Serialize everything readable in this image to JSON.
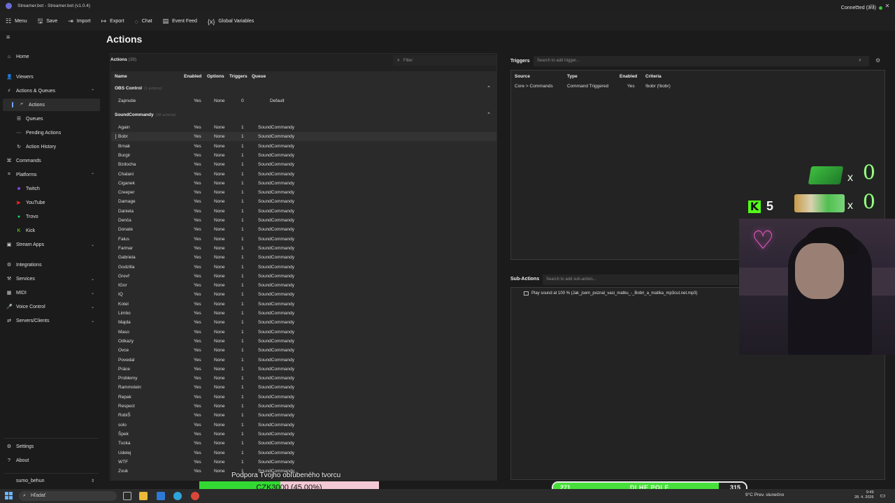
{
  "window": {
    "title": "Streamer.bot - Streamer.bot (v1.0.4)"
  },
  "menu": [
    {
      "icon": "grid-icon",
      "glyph": "☷",
      "label": "Menu"
    },
    {
      "icon": "save-icon",
      "glyph": "🖫",
      "label": "Save"
    },
    {
      "icon": "import-icon",
      "glyph": "⇥",
      "label": "Import"
    },
    {
      "icon": "export-icon",
      "glyph": "↦",
      "label": "Export"
    },
    {
      "icon": "chat-icon",
      "glyph": "◌",
      "label": "Chat"
    },
    {
      "icon": "event-feed-icon",
      "glyph": "▤",
      "label": "Event Feed"
    },
    {
      "icon": "variables-icon",
      "glyph": "{x}",
      "label": "Global Variables"
    }
  ],
  "connection": {
    "label": "Connected (3/3)",
    "color": "#3fbf3f"
  },
  "sidebar": {
    "items": [
      {
        "label": "Home",
        "glyph": "⌂",
        "name": "home"
      },
      {
        "label": "Viewers",
        "glyph": "👤",
        "name": "viewers"
      },
      {
        "label": "Actions & Queues",
        "glyph": "⚡",
        "name": "actions-queues",
        "chev": "⌃"
      },
      {
        "label": "Actions",
        "glyph": "🗲",
        "name": "actions",
        "sub": true,
        "active": true
      },
      {
        "label": "Queues",
        "glyph": "☰",
        "name": "queues",
        "sub": true
      },
      {
        "label": "Pending Actions",
        "glyph": "⋯",
        "name": "pending-actions",
        "sub": true
      },
      {
        "label": "Action History",
        "glyph": "↻",
        "name": "action-history",
        "sub": true
      },
      {
        "label": "Commands",
        "glyph": "⌘",
        "name": "commands"
      },
      {
        "label": "Platforms",
        "glyph": "⌗",
        "name": "platforms",
        "chev": "⌃"
      },
      {
        "label": "Twitch",
        "glyph": "■",
        "name": "twitch",
        "sub": true,
        "color": "#9146ff"
      },
      {
        "label": "YouTube",
        "glyph": "▶",
        "name": "youtube",
        "sub": true,
        "color": "#ff2020"
      },
      {
        "label": "Trovo",
        "glyph": "●",
        "name": "trovo",
        "sub": true,
        "color": "#19d66b"
      },
      {
        "label": "Kick",
        "glyph": "K",
        "name": "kick",
        "sub": true,
        "color": "#53fc18"
      },
      {
        "label": "Stream Apps",
        "glyph": "▣",
        "name": "stream-apps",
        "chev": "⌄"
      },
      {
        "label": "Integrations",
        "glyph": "⚙",
        "name": "integrations"
      },
      {
        "label": "Services",
        "glyph": "⚒",
        "name": "services",
        "chev": "⌄"
      },
      {
        "label": "MIDI",
        "glyph": "▦",
        "name": "midi",
        "chev": "⌄"
      },
      {
        "label": "Voice Control",
        "glyph": "🎤",
        "name": "voice-control",
        "chev": "⌄"
      },
      {
        "label": "Servers/Clients",
        "glyph": "⇄",
        "name": "servers-clients",
        "chev": "⌄"
      }
    ],
    "bottom": [
      {
        "label": "Settings",
        "glyph": "⚙",
        "name": "settings"
      },
      {
        "label": "About",
        "glyph": "?",
        "name": "about"
      }
    ],
    "user": {
      "label": "sumo_behun",
      "chev": "⇕"
    }
  },
  "page": {
    "title": "Actions"
  },
  "actions": {
    "heading": "Actions",
    "count": "(39)",
    "filter_placeholder": "Filter",
    "columns": {
      "name": "Name",
      "enabled": "Enabled",
      "options": "Options",
      "triggers": "Triggers",
      "queue": "Queue"
    },
    "groups": [
      {
        "name": "OBS Control",
        "count": "(1 actions)",
        "rows": [
          {
            "name": "Zapnutie",
            "enabled": "Yes",
            "options": "None",
            "triggers": "0",
            "queue": "Default"
          }
        ]
      },
      {
        "name": "SoundCommandy",
        "count": "(38 actions)",
        "rows": [
          {
            "name": "Again",
            "enabled": "Yes",
            "options": "None",
            "triggers": "1",
            "queue": "SoundCommandy"
          },
          {
            "name": "Bobr",
            "enabled": "Yes",
            "options": "None",
            "triggers": "1",
            "queue": "SoundCommandy",
            "selected": true
          },
          {
            "name": "Brnak",
            "enabled": "Yes",
            "options": "None",
            "triggers": "1",
            "queue": "SoundCommandy"
          },
          {
            "name": "Burgir",
            "enabled": "Yes",
            "options": "None",
            "triggers": "1",
            "queue": "SoundCommandy"
          },
          {
            "name": "Bzdocha",
            "enabled": "Yes",
            "options": "None",
            "triggers": "1",
            "queue": "SoundCommandy"
          },
          {
            "name": "Chalani",
            "enabled": "Yes",
            "options": "None",
            "triggers": "1",
            "queue": "SoundCommandy"
          },
          {
            "name": "Ciganek",
            "enabled": "Yes",
            "options": "None",
            "triggers": "1",
            "queue": "SoundCommandy"
          },
          {
            "name": "Creeper",
            "enabled": "Yes",
            "options": "None",
            "triggers": "1",
            "queue": "SoundCommandy"
          },
          {
            "name": "Damage",
            "enabled": "Yes",
            "options": "None",
            "triggers": "1",
            "queue": "SoundCommandy"
          },
          {
            "name": "Daniela",
            "enabled": "Yes",
            "options": "None",
            "triggers": "1",
            "queue": "SoundCommandy"
          },
          {
            "name": "Denča",
            "enabled": "Yes",
            "options": "None",
            "triggers": "1",
            "queue": "SoundCommandy"
          },
          {
            "name": "Donate",
            "enabled": "Yes",
            "options": "None",
            "triggers": "1",
            "queue": "SoundCommandy"
          },
          {
            "name": "Falus",
            "enabled": "Yes",
            "options": "None",
            "triggers": "1",
            "queue": "SoundCommandy"
          },
          {
            "name": "Farmar",
            "enabled": "Yes",
            "options": "None",
            "triggers": "1",
            "queue": "SoundCommandy"
          },
          {
            "name": "Gabriela",
            "enabled": "Yes",
            "options": "None",
            "triggers": "1",
            "queue": "SoundCommandy"
          },
          {
            "name": "Godzilla",
            "enabled": "Yes",
            "options": "None",
            "triggers": "1",
            "queue": "SoundCommandy"
          },
          {
            "name": "Grevf",
            "enabled": "Yes",
            "options": "None",
            "triggers": "1",
            "queue": "SoundCommandy"
          },
          {
            "name": "IGor",
            "enabled": "Yes",
            "options": "None",
            "triggers": "1",
            "queue": "SoundCommandy"
          },
          {
            "name": "IQ",
            "enabled": "Yes",
            "options": "None",
            "triggers": "1",
            "queue": "SoundCommandy"
          },
          {
            "name": "Kotel",
            "enabled": "Yes",
            "options": "None",
            "triggers": "1",
            "queue": "SoundCommandy"
          },
          {
            "name": "Limbo",
            "enabled": "Yes",
            "options": "None",
            "triggers": "1",
            "queue": "SoundCommandy"
          },
          {
            "name": "Majda",
            "enabled": "Yes",
            "options": "None",
            "triggers": "1",
            "queue": "SoundCommandy"
          },
          {
            "name": "Maso",
            "enabled": "Yes",
            "options": "None",
            "triggers": "1",
            "queue": "SoundCommandy"
          },
          {
            "name": "Odkazy",
            "enabled": "Yes",
            "options": "None",
            "triggers": "1",
            "queue": "SoundCommandy"
          },
          {
            "name": "Ovce",
            "enabled": "Yes",
            "options": "None",
            "triggers": "1",
            "queue": "SoundCommandy"
          },
          {
            "name": "Povedal",
            "enabled": "Yes",
            "options": "None",
            "triggers": "1",
            "queue": "SoundCommandy"
          },
          {
            "name": "Práce",
            "enabled": "Yes",
            "options": "None",
            "triggers": "1",
            "queue": "SoundCommandy"
          },
          {
            "name": "Problemy",
            "enabled": "Yes",
            "options": "None",
            "triggers": "1",
            "queue": "SoundCommandy"
          },
          {
            "name": "Rammstein",
            "enabled": "Yes",
            "options": "None",
            "triggers": "1",
            "queue": "SoundCommandy"
          },
          {
            "name": "Repak",
            "enabled": "Yes",
            "options": "None",
            "triggers": "1",
            "queue": "SoundCommandy"
          },
          {
            "name": "Respect",
            "enabled": "Yes",
            "options": "None",
            "triggers": "1",
            "queue": "SoundCommandy"
          },
          {
            "name": "RobiŠ",
            "enabled": "Yes",
            "options": "None",
            "triggers": "1",
            "queue": "SoundCommandy"
          },
          {
            "name": "solo",
            "enabled": "Yes",
            "options": "None",
            "triggers": "1",
            "queue": "SoundCommandy"
          },
          {
            "name": "Špek",
            "enabled": "Yes",
            "options": "None",
            "triggers": "1",
            "queue": "SoundCommandy"
          },
          {
            "name": "Tucka",
            "enabled": "Yes",
            "options": "None",
            "triggers": "1",
            "queue": "SoundCommandy"
          },
          {
            "name": "Udelej",
            "enabled": "Yes",
            "options": "None",
            "triggers": "1",
            "queue": "SoundCommandy"
          },
          {
            "name": "WTF",
            "enabled": "Yes",
            "options": "None",
            "triggers": "1",
            "queue": "SoundCommandy"
          },
          {
            "name": "Zvuk",
            "enabled": "Yes",
            "options": "None",
            "triggers": "1",
            "queue": "SoundCommandy"
          }
        ]
      }
    ]
  },
  "triggers": {
    "title": "Triggers",
    "search_placeholder": "Search to add trigger...",
    "columns": {
      "source": "Source",
      "type": "Type",
      "enabled": "Enabled",
      "criteria": "Criteria"
    },
    "rows": [
      {
        "source": "Core > Commands",
        "type": "Command Triggered",
        "enabled": "Yes",
        "criteria": "!bobr (!bobr)"
      }
    ]
  },
  "subactions": {
    "title": "Sub-Actions",
    "search_placeholder": "Search to add sub-action...",
    "items": [
      "Play sound at 100 % (Jak_jsem_poznal_vasi_matku_-_Bobri_a_matika_mp3cut.net.mp3)"
    ]
  },
  "overlay": {
    "kick_count": "5",
    "shot_counts": [
      "0",
      "0"
    ],
    "x_mark": "x",
    "support_text": "Podpora Tvojho obľúbeného tvorcu",
    "support_label": "CZK3000 (45.00%)",
    "support_fraction": 0.45,
    "progress_left": "271",
    "progress_label": "DLHE POLE",
    "progress_right": "315",
    "progress_fraction": 0.86,
    "colors": {
      "kick_green": "#53fc18",
      "fill_green": "#33d933",
      "support_bg": "#f2c9d4"
    }
  },
  "taskbar": {
    "search_placeholder": "Hľadať",
    "weather": "9°C  Prev. slunečno",
    "time": "9:49",
    "date": "28. 4. 2026"
  }
}
